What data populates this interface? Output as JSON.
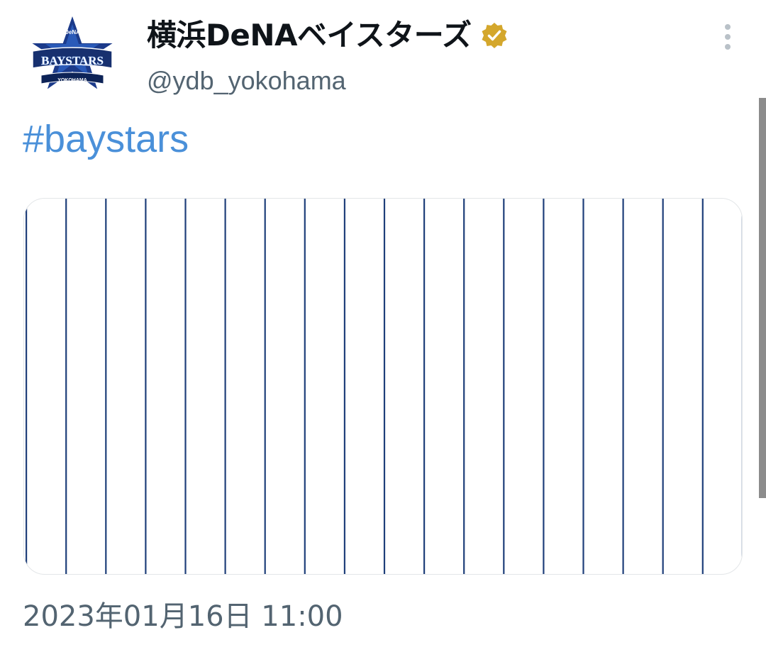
{
  "account": {
    "display_name": "横浜DeNAベイスターズ",
    "handle": "@ydb_yokohama",
    "verified": true,
    "verified_color": "#d4a72c",
    "avatar_logo": {
      "top_text": "DeNA",
      "main_text": "BAYSTARS",
      "bottom_text": "YOKOHAMA"
    }
  },
  "menu": {
    "icon": "more-vertical-icon"
  },
  "tweet": {
    "hashtag": "#baystars",
    "hashtag_color": "#4a90d9",
    "media": {
      "description": "pinstripe",
      "stripe_color": "#1f3f7a"
    },
    "timestamp": "2023年01月16日 11:00"
  }
}
